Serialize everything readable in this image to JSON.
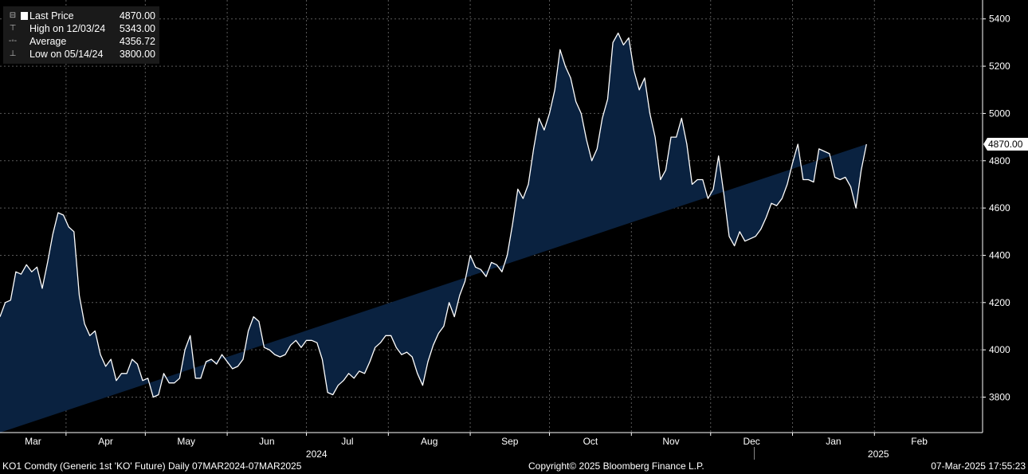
{
  "chart_data": {
    "type": "area",
    "ylim": [
      3650,
      5480
    ],
    "y_ticks": [
      3800,
      4000,
      4200,
      4400,
      4600,
      4800,
      5000,
      5200,
      5400
    ],
    "x_month_labels": [
      "Mar",
      "Apr",
      "May",
      "Jun",
      "Jul",
      "Aug",
      "Sep",
      "Oct",
      "Nov",
      "Dec",
      "Jan",
      "Feb"
    ],
    "x_year_labels": [
      "2024",
      "2025"
    ],
    "last_price_label": "4870.00",
    "series": [
      {
        "name": "Last Price",
        "dates": [
          "2024-03-07",
          "2024-03-09",
          "2024-03-11",
          "2024-03-13",
          "2024-03-15",
          "2024-03-17",
          "2024-03-19",
          "2024-03-21",
          "2024-03-23",
          "2024-03-25",
          "2024-03-27",
          "2024-03-29",
          "2024-03-31",
          "2024-04-02",
          "2024-04-04",
          "2024-04-06",
          "2024-04-08",
          "2024-04-10",
          "2024-04-12",
          "2024-04-14",
          "2024-04-16",
          "2024-04-18",
          "2024-04-20",
          "2024-04-22",
          "2024-04-24",
          "2024-04-26",
          "2024-04-28",
          "2024-04-30",
          "2024-05-02",
          "2024-05-04",
          "2024-05-06",
          "2024-05-08",
          "2024-05-10",
          "2024-05-12",
          "2024-05-14",
          "2024-05-16",
          "2024-05-18",
          "2024-05-20",
          "2024-05-22",
          "2024-05-24",
          "2024-05-26",
          "2024-05-28",
          "2024-05-30",
          "2024-06-01",
          "2024-06-03",
          "2024-06-05",
          "2024-06-07",
          "2024-06-09",
          "2024-06-11",
          "2024-06-13",
          "2024-06-15",
          "2024-06-17",
          "2024-06-19",
          "2024-06-21",
          "2024-06-23",
          "2024-06-25",
          "2024-06-27",
          "2024-06-29",
          "2024-07-01",
          "2024-07-03",
          "2024-07-05",
          "2024-07-07",
          "2024-07-09",
          "2024-07-11",
          "2024-07-13",
          "2024-07-15",
          "2024-07-17",
          "2024-07-19",
          "2024-07-21",
          "2024-07-23",
          "2024-07-25",
          "2024-07-27",
          "2024-07-29",
          "2024-07-31",
          "2024-08-02",
          "2024-08-04",
          "2024-08-06",
          "2024-08-08",
          "2024-08-10",
          "2024-08-12",
          "2024-08-14",
          "2024-08-16",
          "2024-08-18",
          "2024-08-20",
          "2024-08-22",
          "2024-08-24",
          "2024-08-26",
          "2024-08-28",
          "2024-08-30",
          "2024-09-01",
          "2024-09-03",
          "2024-09-05",
          "2024-09-07",
          "2024-09-09",
          "2024-09-11",
          "2024-09-13",
          "2024-09-15",
          "2024-09-17",
          "2024-09-19",
          "2024-09-21",
          "2024-09-23",
          "2024-09-25",
          "2024-09-27",
          "2024-09-29",
          "2024-10-01",
          "2024-10-03",
          "2024-10-05",
          "2024-10-07",
          "2024-10-09",
          "2024-10-11",
          "2024-10-13",
          "2024-10-15",
          "2024-10-17",
          "2024-10-19",
          "2024-10-21",
          "2024-10-23",
          "2024-10-25",
          "2024-10-27",
          "2024-10-29",
          "2024-10-31",
          "2024-11-02",
          "2024-11-04",
          "2024-11-06",
          "2024-11-08",
          "2024-11-10",
          "2024-11-12",
          "2024-11-14",
          "2024-11-16",
          "2024-11-18",
          "2024-11-20",
          "2024-11-22",
          "2024-11-24",
          "2024-11-26",
          "2024-11-28",
          "2024-11-30",
          "2024-12-02",
          "2024-12-04",
          "2024-12-06",
          "2024-12-08",
          "2024-12-10",
          "2024-12-12",
          "2024-12-14",
          "2024-12-16",
          "2024-12-18",
          "2024-12-20",
          "2024-12-22",
          "2024-12-24",
          "2024-12-26",
          "2024-12-28",
          "2024-12-30",
          "2025-01-01",
          "2025-01-03",
          "2025-01-05",
          "2025-01-07",
          "2025-01-09",
          "2025-01-11",
          "2025-01-13",
          "2025-01-15",
          "2025-01-17",
          "2025-01-19",
          "2025-01-21",
          "2025-01-23",
          "2025-01-25",
          "2025-01-27",
          "2025-01-29",
          "2025-01-31",
          "2025-02-02",
          "2025-02-04",
          "2025-02-06",
          "2025-02-08",
          "2025-02-10",
          "2025-02-12",
          "2025-02-14",
          "2025-02-16",
          "2025-02-18",
          "2025-02-20",
          "2025-02-22",
          "2025-02-24",
          "2025-02-26",
          "2025-02-28",
          "2025-03-02",
          "2025-03-04",
          "2025-03-07"
        ],
        "values": [
          4140,
          4200,
          4210,
          4330,
          4320,
          4360,
          4330,
          4350,
          4260,
          4370,
          4490,
          4580,
          4570,
          4520,
          4500,
          4230,
          4110,
          4060,
          4080,
          3980,
          3930,
          3960,
          3870,
          3900,
          3900,
          3960,
          3940,
          3870,
          3880,
          3800,
          3810,
          3900,
          3860,
          3860,
          3880,
          4000,
          4060,
          3880,
          3880,
          3950,
          3960,
          3940,
          3980,
          3950,
          3920,
          3930,
          3960,
          4080,
          4140,
          4120,
          4010,
          4000,
          3980,
          3970,
          3980,
          4020,
          4040,
          4010,
          4040,
          4040,
          4030,
          3960,
          3820,
          3810,
          3850,
          3870,
          3900,
          3880,
          3910,
          3900,
          3950,
          4010,
          4030,
          4060,
          4060,
          4010,
          3980,
          3990,
          3970,
          3900,
          3850,
          3950,
          4020,
          4070,
          4100,
          4200,
          4140,
          4230,
          4290,
          4400,
          4350,
          4340,
          4310,
          4370,
          4360,
          4330,
          4400,
          4530,
          4680,
          4640,
          4700,
          4850,
          4980,
          4930,
          5000,
          5100,
          5270,
          5200,
          5150,
          5050,
          5000,
          4890,
          4800,
          4850,
          4980,
          5060,
          5300,
          5340,
          5290,
          5320,
          5180,
          5100,
          5150,
          5000,
          4900,
          4720,
          4760,
          4900,
          4900,
          4980,
          4870,
          4700,
          4720,
          4720,
          4640,
          4680,
          4820,
          4660,
          4480,
          4440,
          4500,
          4460,
          4470,
          4480,
          4510,
          4560,
          4620,
          4610,
          4640,
          4700,
          4790,
          4870,
          4720,
          4720,
          4710,
          4850,
          4840,
          4830,
          4730,
          4720,
          4730,
          4690,
          4600,
          4760,
          4870
        ]
      }
    ],
    "stats": {
      "high_label": "High on 12/03/24",
      "high_value": "5343.00",
      "avg_label": "Average",
      "avg_value": "4356.72",
      "low_label": "Low on 05/14/24",
      "low_value": "3800.00",
      "last_label": "Last Price",
      "last_value": "4870.00"
    },
    "grid": true,
    "legend_position": "top-left",
    "colors": {
      "background": "#000000",
      "area_fill": "#0a2240",
      "line": "#ffffff",
      "grid": "#5a5a5a"
    }
  },
  "footer": {
    "left": "KO1 Comdty (Generic 1st 'KO' Future)  Daily 07MAR2024-07MAR2025",
    "center": "Copyright© 2025 Bloomberg Finance L.P.",
    "right": "07-Mar-2025 17:55:23"
  }
}
